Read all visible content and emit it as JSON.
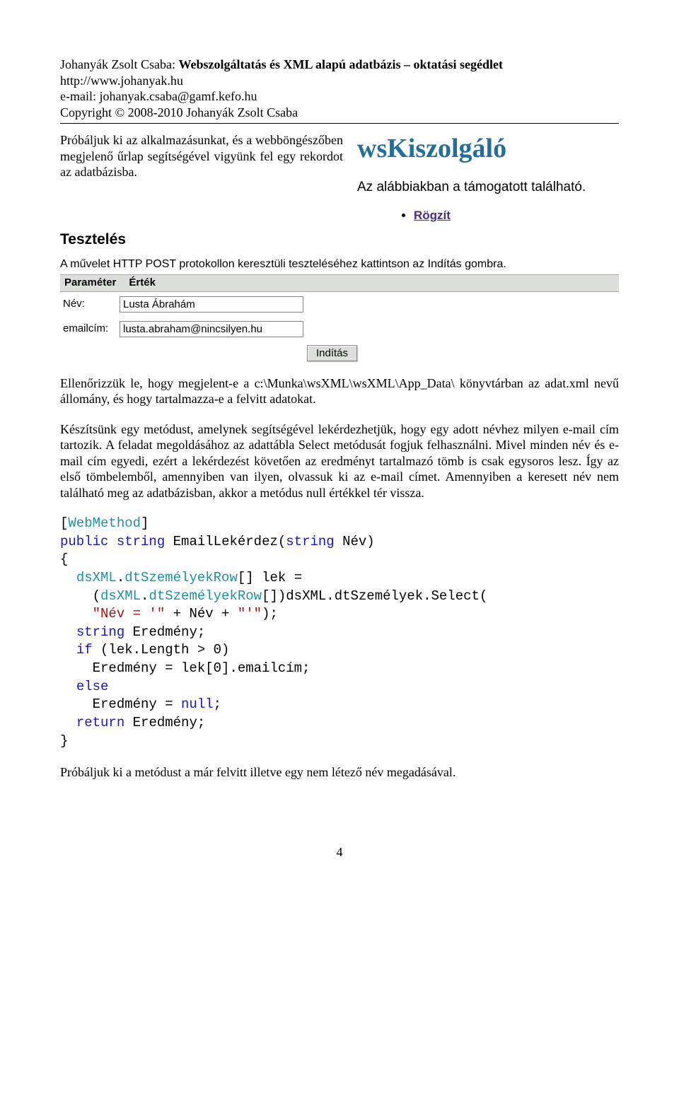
{
  "header": {
    "author": "Johanyák Zsolt Csaba:",
    "title_bold": "Webszolgáltatás és XML alapú adatbázis – oktatási segédlet",
    "url": "http://www.johanyak.hu",
    "email": "e-mail: johanyak.csaba@gamf.kefo.hu",
    "copyright": "Copyright © 2008-2010 Johanyák Zsolt Csaba"
  },
  "intro_para": "Próbáljuk ki az alkalmazásunkat, és a webböngészőben megjelenő űrlap segítségével vigyünk fel egy rekordot az adatbázisba.",
  "ws": {
    "logo": "wsKiszolgáló",
    "sub": "Az alábbiakban a támogatott található.",
    "link": "Rögzít"
  },
  "test": {
    "title": "Tesztelés",
    "desc": "A művelet HTTP POST protokollon keresztüli teszteléséhez kattintson az Indítás gombra.",
    "head_param": "Paraméter",
    "head_val": "Érték",
    "row1_label": "Név:",
    "row1_value": "Lusta Ábrahám",
    "row2_label": "emailcím:",
    "row2_value": "lusta.abraham@nincsilyen.hu",
    "submit": "Indítás"
  },
  "para2": "Ellenőrizzük le, hogy megjelent-e a c:\\Munka\\wsXML\\wsXML\\App_Data\\ könyvtárban az adat.xml nevű állomány, és hogy tartalmazza-e a felvitt adatokat.",
  "para3": "Készítsünk egy metódust, amelynek segítségével lekérdezhetjük, hogy egy adott névhez milyen e-mail cím tartozik. A feladat megoldásához az adattábla Select metódusát fogjuk felhasználni. Mivel minden név és e-mail cím egyedi, ezért a lekérdezést követően az eredményt tartalmazó tömb is csak egysoros lesz. Így az első tömbelemből, amennyiben van ilyen, olvassuk ki az e-mail címet. Amennyiben a keresett név nem található meg az adatbázisban, akkor a metódus null értékkel tér vissza.",
  "code": {
    "l1a": "[",
    "l1b": "WebMethod",
    "l1c": "]",
    "l2a": "public",
    "l2b": " ",
    "l2c": "string",
    "l2d": " EmailLekérdez(",
    "l2e": "string",
    "l2f": " Név)",
    "l3": "{",
    "l4a": "  ",
    "l4b": "dsXML",
    "l4c": ".",
    "l4d": "dtSzemélyekRow",
    "l4e": "[] lek =",
    "l5a": "    (",
    "l5b": "dsXML",
    "l5c": ".",
    "l5d": "dtSzemélyekRow",
    "l5e": "[])dsXML.dtSzemélyek.Select(",
    "l6a": "    ",
    "l6b": "\"Név = '\"",
    "l6c": " + Név + ",
    "l6d": "\"'\"",
    "l6e": ");",
    "l7a": "  ",
    "l7b": "string",
    "l7c": " Eredmény;",
    "l8a": "  ",
    "l8b": "if",
    "l8c": " (lek.Length > 0)",
    "l9": "    Eredmény = lek[0].emailcím;",
    "l10a": "  ",
    "l10b": "else",
    "l11a": "    Eredmény = ",
    "l11b": "null",
    "l11c": ";",
    "l12a": "  ",
    "l12b": "return",
    "l12c": " Eredmény;",
    "l13": "}"
  },
  "para4": "Próbáljuk ki a metódust a már felvitt illetve egy nem létező név megadásával.",
  "page": "4"
}
